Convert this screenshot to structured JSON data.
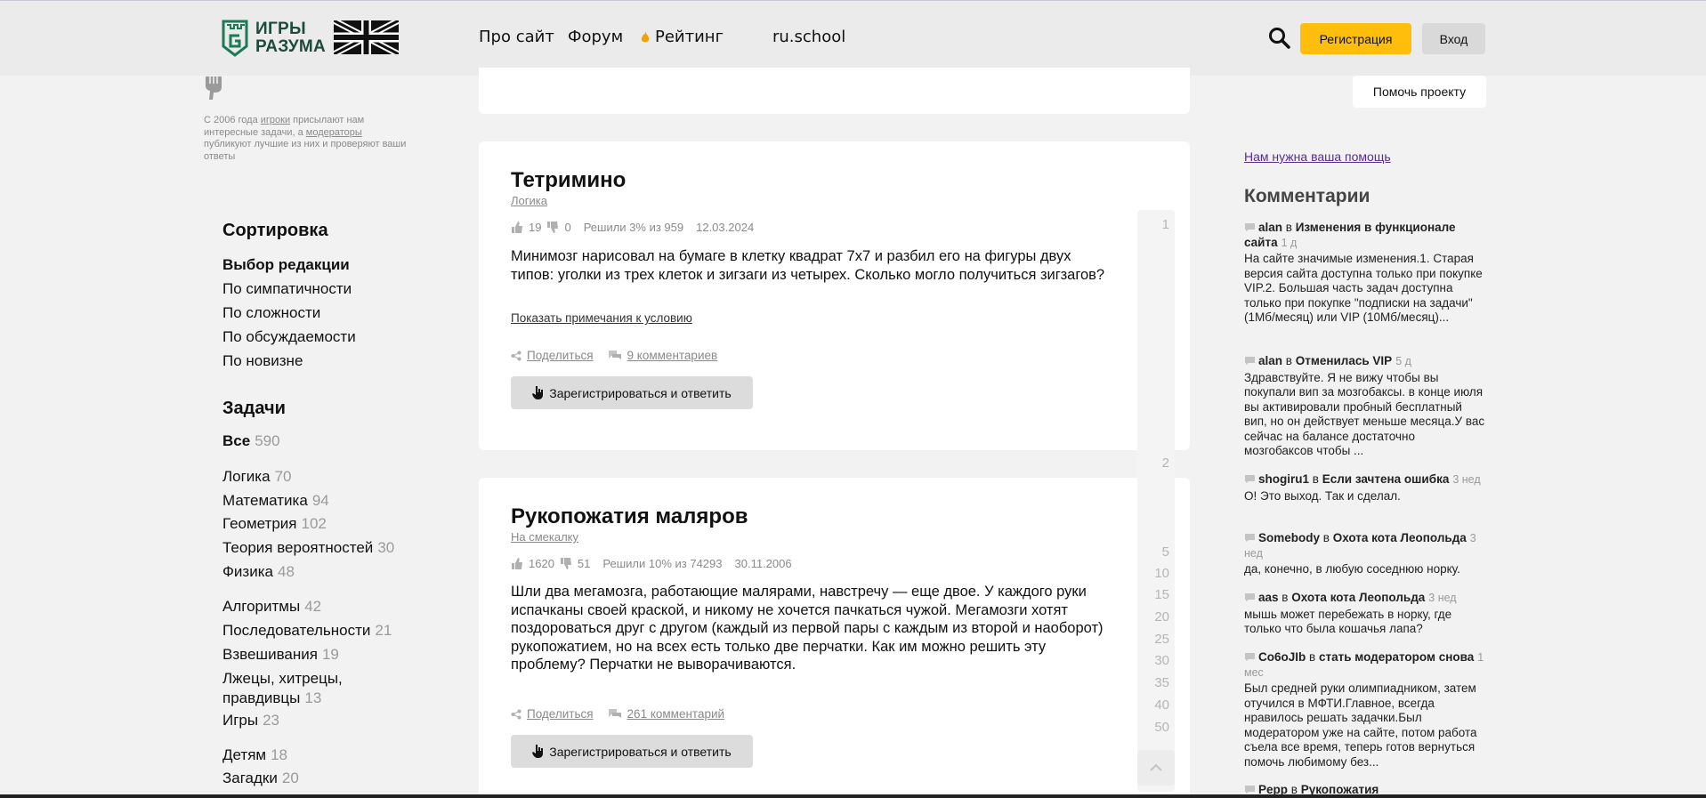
{
  "header": {
    "logo_text_line1": "ИГРЫ",
    "logo_text_line2": "РАЗУМА",
    "nav": [
      "Про сайт",
      "Форум",
      "Рейтинг",
      "ru.school"
    ],
    "register_label": "Регистрация",
    "login_label": "Вход",
    "brand_color": "#1d4a3c",
    "accent_color": "#ffbe0b"
  },
  "sidebar": {
    "intro_parts": [
      "С 2006 года ",
      "игроки",
      " присылают нам интересные задачи, а ",
      "модераторы",
      " публикуют лучшие из них и проверяют ваши ответы"
    ],
    "sort_title": "Сортировка",
    "sort_items": [
      "Выбор редакции",
      "По симпатичности",
      "По сложности",
      "По обсуждаемости",
      "По новизне"
    ],
    "tasks_title": "Задачи",
    "categories": [
      {
        "label": "Все",
        "count": "590"
      },
      {
        "label": "Логика",
        "count": "70"
      },
      {
        "label": "Математика",
        "count": "94"
      },
      {
        "label": "Геометрия",
        "count": "102"
      },
      {
        "label": "Теория вероятностей",
        "count": "30"
      },
      {
        "label": "Физика",
        "count": "48"
      },
      {
        "label": "Алгоритмы",
        "count": "42"
      },
      {
        "label": "Последовательности",
        "count": "21"
      },
      {
        "label": "Взвешивания",
        "count": "19"
      },
      {
        "label": "Лжецы, хитрецы,",
        "label2": "правдивцы",
        "count": "13"
      },
      {
        "label": "Игры",
        "count": "23"
      },
      {
        "label": "Детям",
        "count": "18"
      },
      {
        "label": "Загадки",
        "count": "20"
      }
    ]
  },
  "problems": [
    {
      "title": "Тетримино",
      "category": "Логика",
      "likes": "19",
      "dislikes": "0",
      "solved": "Решили 3% из 959",
      "date": "12.03.2024",
      "text": "Минимозг нарисовал на бумаге в клетку квадрат 7x7 и разбил его на фигуры двух типов: уголки из трех клеток и зигзаги из четырех. Сколько могло получиться зигзагов?",
      "notes_link": "Показать примечания к условию",
      "share": "Поделиться",
      "comments": "9 комментариев",
      "answer_button": "Зарегистрироваться и ответить"
    },
    {
      "title": "Рукопожатия маляров",
      "category": "На смекалку",
      "likes": "1620",
      "dislikes": "51",
      "solved": "Решили 10% из 74293",
      "date": "30.11.2006",
      "text": "Шли два мегамозга, работающие малярами, навстречу — еще двое. У каждого руки испачканы своей краской, и никому не хочется пачкаться чужой. Мегамозги хотят поздороваться друг с другом (каждый из первой пары с каждым из второй и наоборот) рукопожатием, но на всех есть только две перчатки. Как им можно решить эту проблему? Перчатки не выворачиваются.",
      "share": "Поделиться",
      "comments": "261 комментарий",
      "answer_button": "Зарегистрироваться и ответить"
    }
  ],
  "pager": [
    "1",
    "2",
    "5",
    "10",
    "15",
    "20",
    "25",
    "30",
    "35",
    "40",
    "50"
  ],
  "right": {
    "help_button": "Помочь проекту",
    "need_help": "Нам нужна ваша помощь",
    "comments_title": "Комментарии",
    "comments": [
      {
        "author": "alan",
        "in": "в",
        "topic": "Изменения в функционале сайта",
        "ago": "1 д",
        "text": "На сайте значимые изменения.1. Старая версия сайта доступна только при покупке VIP.2. Большая часть задач доступна только при покупке \"подписки на задачи\" (1Мб/месяц) или VIP (10Мб/месяц)..."
      },
      {
        "author": "alan",
        "in": "в",
        "topic": "Отменилась VIP",
        "ago": "5 д",
        "text": "Здравствуйте. Я не вижу чтобы вы покупали вип за мозгобаксы. в конце июля вы активировали пробный бесплатный вип, но он действует меньше месяца.У вас сейчас на балансе достаточно мозгобаксов чтобы ..."
      },
      {
        "author": "shogiru1",
        "in": "в",
        "topic": "Если зачтена ошибка",
        "ago": "3 нед",
        "text": "О! Это выход. Так и сделал."
      },
      {
        "author": "Somebody",
        "in": "в",
        "topic": "Охота кота Леопольда",
        "ago": "3 нед",
        "text": "да, конечно, в любую соседнюю норку."
      },
      {
        "author": "aas",
        "in": "в",
        "topic": "Охота кота Леопольда",
        "ago": "3 нед",
        "text": "мышь может перебежать в норку, где только что была кошачья лапа?"
      },
      {
        "author": "Co6oJIb",
        "in": "в",
        "topic": "стать модератором снова",
        "ago": "1 мес",
        "text": "Был средней руки олимпиадником, затем отучился в МФТИ.Главное, всегда нравилось решать задачки.Был модератором уже на сайте, потом работа съела все время, теперь готов вернуться помочь любимому без..."
      },
      {
        "author": "Pepp",
        "in": "в",
        "topic": "Рукопожатия",
        "ago": "",
        "text": ""
      }
    ]
  }
}
